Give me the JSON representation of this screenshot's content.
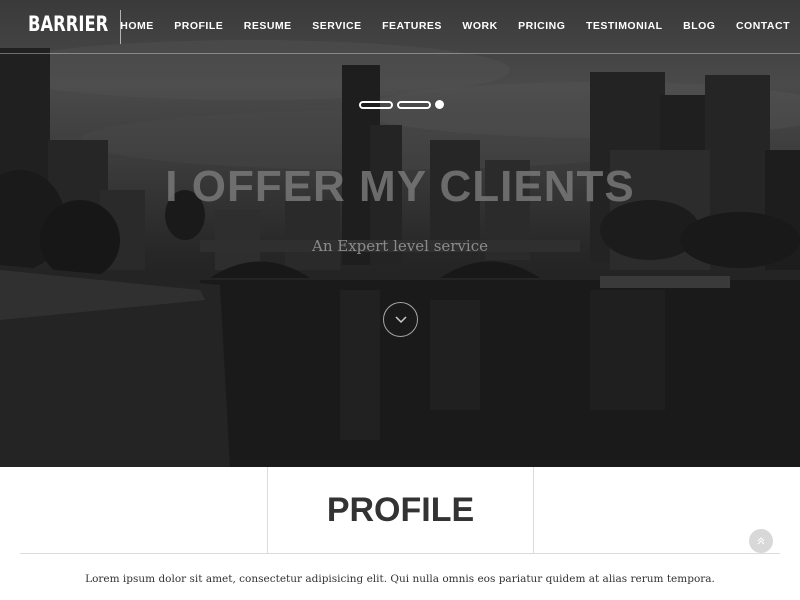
{
  "header": {
    "logo": "BARRIER",
    "nav": [
      "HOME",
      "PROFILE",
      "RESUME",
      "SERVICE",
      "FEATURES",
      "WORK",
      "PRICING",
      "TESTIMONIAL",
      "BLOG",
      "CONTACT"
    ]
  },
  "hero": {
    "title": "I OFFER MY CLIENTS",
    "subtitle": "An Expert level service",
    "scroll_icon": "chevron-down-icon",
    "slider_active_index": 2,
    "slider_count": 3
  },
  "profile": {
    "title": "PROFILE",
    "text": "Lorem ipsum dolor sit amet, consectetur adipisicing elit. Qui nulla omnis eos pariatur quidem at alias rerum tempora."
  },
  "back_to_top_icon": "double-chevron-up-icon",
  "colors": {
    "hero_overlay": "#1c1c1c",
    "text_dark": "#333333",
    "divider": "#dcdcdc",
    "white": "#ffffff"
  }
}
